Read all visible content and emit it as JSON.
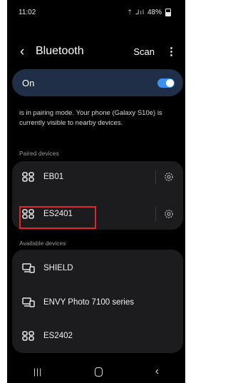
{
  "status_bar": {
    "time": "11:02",
    "indicators": "⇡ ⅃ıl",
    "battery": "48%"
  },
  "app_bar": {
    "title": "Bluetooth",
    "scan_label": "Scan",
    "back_icon": "back-chevron-icon",
    "more_icon": "more-vert-icon"
  },
  "bluetooth_toggle": {
    "label": "On",
    "state": true
  },
  "pairing_text": "is in pairing mode. Your phone (Galaxy S10e) is currently visible to nearby devices.",
  "paired": {
    "header": "Paired devices",
    "devices": [
      {
        "name": "EB01",
        "icon": "bluetooth-generic-icon"
      },
      {
        "name": "ES2401",
        "icon": "bluetooth-generic-icon"
      }
    ]
  },
  "available": {
    "header": "Available devices",
    "devices": [
      {
        "name": "SHIELD",
        "icon": "computer-icon"
      },
      {
        "name": "ENVY Photo 7100 series",
        "icon": "computer-icon"
      },
      {
        "name": "ES2402",
        "icon": "bluetooth-generic-icon"
      }
    ]
  },
  "colors": {
    "background": "#000000",
    "toggle_card": "#1f2f47",
    "switch_on": "#3e91f0",
    "card": "#1c1c1e",
    "highlight": "#e3242b"
  }
}
